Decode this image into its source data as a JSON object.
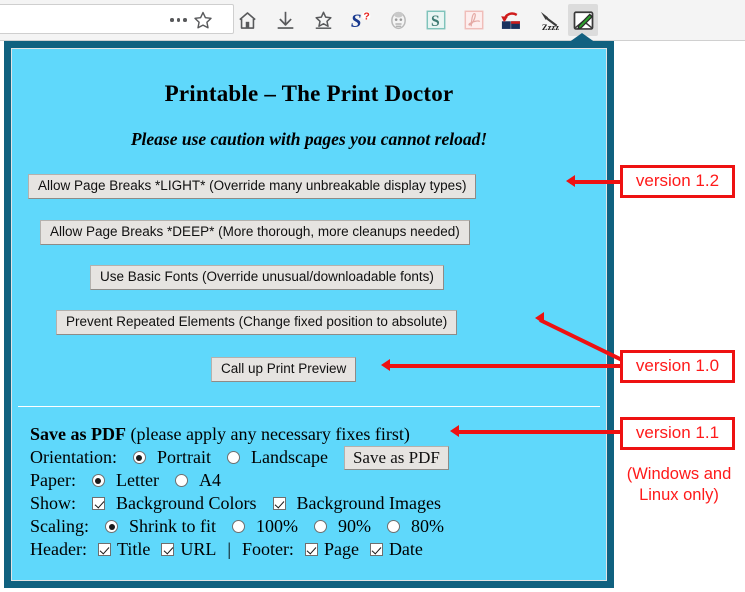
{
  "toolbar": {
    "urlbar_value": "",
    "icons": [
      {
        "name": "more-dots-icon",
        "label": "More"
      },
      {
        "name": "bookmark-star-icon",
        "label": "Bookmark this page"
      },
      {
        "name": "home-icon",
        "label": "Home"
      },
      {
        "name": "downloads-icon",
        "label": "Downloads"
      },
      {
        "name": "save-bookmark-icon",
        "label": "Save to bookmarks"
      },
      {
        "name": "stylish-s-icon",
        "label": "Stylish"
      },
      {
        "name": "privacy-badger-icon",
        "label": "Privacy Badger"
      },
      {
        "name": "scrapbook-s-icon",
        "label": "ScrapBook"
      },
      {
        "name": "pdf-icon",
        "label": "PDF"
      },
      {
        "name": "undo-close-tab-icon",
        "label": "Undo Close Tab"
      },
      {
        "name": "hammer-zzz-icon",
        "label": "Tab Suspender"
      },
      {
        "name": "printable-pen-icon",
        "label": "Printable – The Print Doctor"
      }
    ]
  },
  "panel": {
    "title": "Printable – The Print Doctor",
    "subtitle": "Please use caution with pages you cannot reload!",
    "buttons": [
      {
        "id": "allow-page-breaks-light",
        "label": "Allow Page Breaks *LIGHT* (Override many unbreakable display types)"
      },
      {
        "id": "allow-page-breaks-deep",
        "label": "Allow Page Breaks *DEEP* (More thorough, more cleanups needed)"
      },
      {
        "id": "use-basic-fonts",
        "label": "Use Basic Fonts (Override unusual/downloadable fonts)"
      },
      {
        "id": "prevent-repeated-elements",
        "label": "Prevent Repeated Elements (Change fixed position to absolute)"
      },
      {
        "id": "call-up-print-preview",
        "label": "Call up Print Preview"
      }
    ],
    "pdf": {
      "heading_bold": "Save as PDF",
      "heading_rest": " (please apply any necessary fixes first)",
      "orientation_label": "Orientation:",
      "orientation_options": [
        {
          "label": "Portrait",
          "selected": true
        },
        {
          "label": "Landscape",
          "selected": false
        }
      ],
      "save_button_label": "Save as PDF",
      "paper_label": "Paper:",
      "paper_options": [
        {
          "label": "Letter",
          "selected": true
        },
        {
          "label": "A4",
          "selected": false
        }
      ],
      "show_label": "Show:",
      "show_options": [
        {
          "label": "Background Colors",
          "checked": true
        },
        {
          "label": "Background Images",
          "checked": true
        }
      ],
      "scaling_label": "Scaling:",
      "scaling_options": [
        {
          "label": "Shrink to fit",
          "selected": true
        },
        {
          "label": "100%",
          "selected": false
        },
        {
          "label": "90%",
          "selected": false
        },
        {
          "label": "80%",
          "selected": false
        }
      ],
      "header_label": "Header:",
      "header_options": [
        {
          "label": "Title",
          "checked": true
        },
        {
          "label": "URL",
          "checked": true
        }
      ],
      "separator": "|",
      "footer_label": "Footer:",
      "footer_options": [
        {
          "label": "Page",
          "checked": true
        },
        {
          "label": "Date",
          "checked": true
        }
      ]
    }
  },
  "annotations": {
    "version_12": "version 1.2",
    "version_10": "version 1.0",
    "version_11": "version 1.1",
    "platform_note_line1": "(Windows and",
    "platform_note_line2": "Linux only)"
  },
  "colors": {
    "panel_background": "#5fd8fb",
    "panel_border": "#10617f",
    "annotation_red": "#ee1111",
    "button_face": "#e6e4e1"
  }
}
